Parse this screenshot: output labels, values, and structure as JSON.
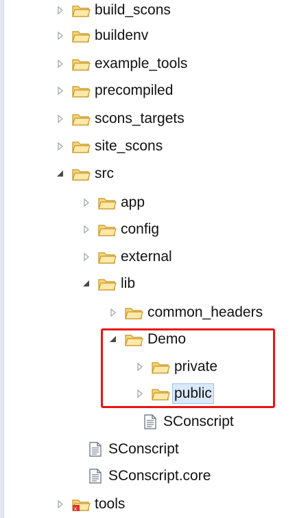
{
  "colors": {
    "highlight_border": "#ee1111",
    "selection_bg": "#d9e9fb",
    "folder_fill": "#f7d57a",
    "folder_stroke": "#c89525"
  },
  "tree": {
    "items": [
      {
        "label": "build_scons",
        "icon": "folder-icon",
        "toggle": "collapsed"
      },
      {
        "label": "buildenv",
        "icon": "folder-icon",
        "toggle": "collapsed"
      },
      {
        "label": "example_tools",
        "icon": "folder-icon",
        "toggle": "collapsed"
      },
      {
        "label": "precompiled",
        "icon": "folder-icon",
        "toggle": "collapsed"
      },
      {
        "label": "scons_targets",
        "icon": "folder-icon",
        "toggle": "collapsed"
      },
      {
        "label": "site_scons",
        "icon": "folder-icon",
        "toggle": "collapsed"
      },
      {
        "label": "src",
        "icon": "folder-icon",
        "toggle": "expanded"
      },
      {
        "label": "app",
        "icon": "folder-icon",
        "toggle": "collapsed"
      },
      {
        "label": "config",
        "icon": "folder-icon",
        "toggle": "collapsed"
      },
      {
        "label": "external",
        "icon": "folder-icon",
        "toggle": "collapsed"
      },
      {
        "label": "lib",
        "icon": "folder-icon",
        "toggle": "expanded"
      },
      {
        "label": "common_headers",
        "icon": "folder-icon",
        "toggle": "collapsed"
      },
      {
        "label": "Demo",
        "icon": "folder-icon",
        "toggle": "expanded"
      },
      {
        "label": "private",
        "icon": "folder-icon",
        "toggle": "collapsed"
      },
      {
        "label": "public",
        "icon": "folder-icon",
        "toggle": "collapsed",
        "selected": true
      },
      {
        "label": "SConscript",
        "icon": "file-icon",
        "toggle": "none"
      },
      {
        "label": "SConscript",
        "icon": "file-icon",
        "toggle": "none"
      },
      {
        "label": "SConscript.core",
        "icon": "file-icon",
        "toggle": "none"
      },
      {
        "label": "tools",
        "icon": "folder-error-icon",
        "toggle": "collapsed"
      }
    ]
  }
}
